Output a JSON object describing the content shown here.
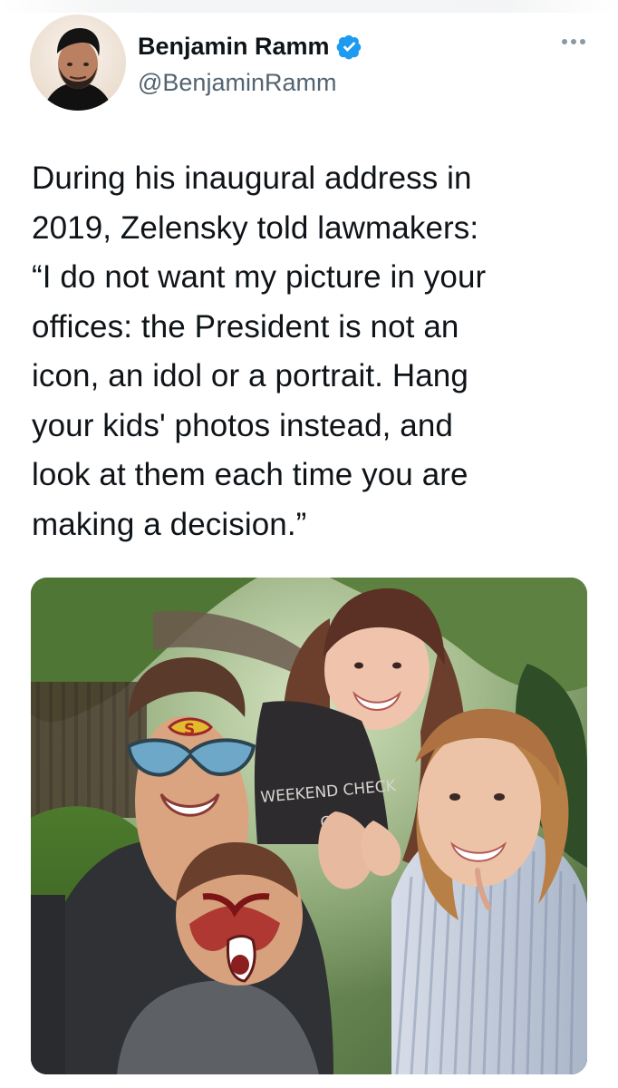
{
  "tweet": {
    "author": {
      "display_name": "Benjamin Ramm",
      "handle": "@BenjaminRamm",
      "verified_icon": "verified-badge-icon",
      "avatar_icon": "avatar-photo"
    },
    "menu_icon": "more-options-icon",
    "text_lines": [
      "During his inaugural address in",
      "2019, Zelensky told lawmakers:",
      "“I do not want my picture in your",
      "offices: the President is not an",
      "icon, an idol or a portrait. Hang",
      "your kids' photos instead, and",
      "look at them each time you are",
      "making a decision.”"
    ],
    "image": {
      "shirt_text_line1": "WEEKEND CHECK",
      "shirt_text_line2": "CR"
    }
  },
  "colors": {
    "text_primary": "#0f1419",
    "text_secondary": "#536471",
    "verified_blue": "#1d9bf0",
    "menu_gray": "#8b98a5",
    "background": "#ffffff"
  }
}
